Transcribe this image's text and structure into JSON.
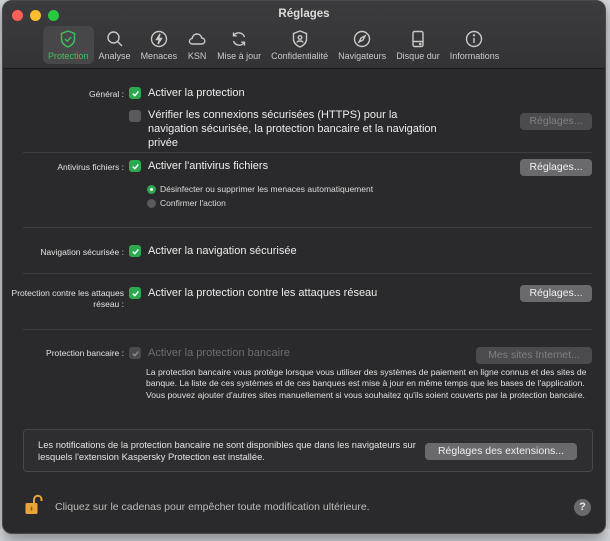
{
  "window": {
    "title": "Réglages"
  },
  "toolbar": {
    "items": [
      {
        "label": "Protection",
        "icon": "shield-check-icon",
        "active": true
      },
      {
        "label": "Analyse",
        "icon": "magnifier-icon"
      },
      {
        "label": "Menaces",
        "icon": "bolt-circle-icon"
      },
      {
        "label": "KSN",
        "icon": "cloud-icon"
      },
      {
        "label": "Mise à jour",
        "icon": "refresh-icon"
      },
      {
        "label": "Confidentialité",
        "icon": "privacy-shield-icon"
      },
      {
        "label": "Navigateurs",
        "icon": "compass-icon"
      },
      {
        "label": "Disque dur",
        "icon": "hard-disk-icon"
      },
      {
        "label": "Informations",
        "icon": "info-icon"
      }
    ]
  },
  "general": {
    "label": "Général :",
    "protection": "Activer la protection",
    "https": "Vérifier les connexions sécurisées (HTTPS) pour la navigation sécurisée, la protection bancaire et la navigation privée",
    "settings_btn": "Réglages..."
  },
  "antivirus": {
    "label": "Antivirus fichiers :",
    "enable": "Activer l'antivirus fichiers",
    "settings_btn": "Réglages...",
    "radio_auto": "Désinfecter ou supprimer les menaces automatiquement",
    "radio_confirm": "Confirmer l'action"
  },
  "navigation": {
    "label": "Navigation sécurisée :",
    "enable": "Activer la navigation sécurisée"
  },
  "network": {
    "label": "Protection contre les attaques réseau :",
    "enable": "Activer la protection contre les attaques réseau",
    "settings_btn": "Réglages..."
  },
  "banking": {
    "label": "Protection bancaire :",
    "enable": "Activer la protection bancaire",
    "sites_btn": "Mes sites Internet...",
    "description": "La protection bancaire vous protège lorsque vous utiliser des systèmes de paiement en ligne connus et des sites de banque. La liste de ces systèmes et de ces banques est mise à jour en même temps que les bases de l'application. Vous pouvez ajouter d'autres sites manuellement si vous souhaitez qu'ils soient couverts par la protection bancaire."
  },
  "notice": {
    "text": "Les notifications de la protection bancaire ne sont disponibles que dans les navigateurs sur lesquels l'extension Kaspersky Protection est installée.",
    "extensions_btn": "Réglages des extensions..."
  },
  "footer": {
    "lock_text": "Cliquez sur le cadenas pour empêcher toute modification ultérieure.",
    "help": "?"
  },
  "colors": {
    "accent": "#3ec25c",
    "checkbox": "#2fa84f",
    "lock": "#e9a534"
  }
}
